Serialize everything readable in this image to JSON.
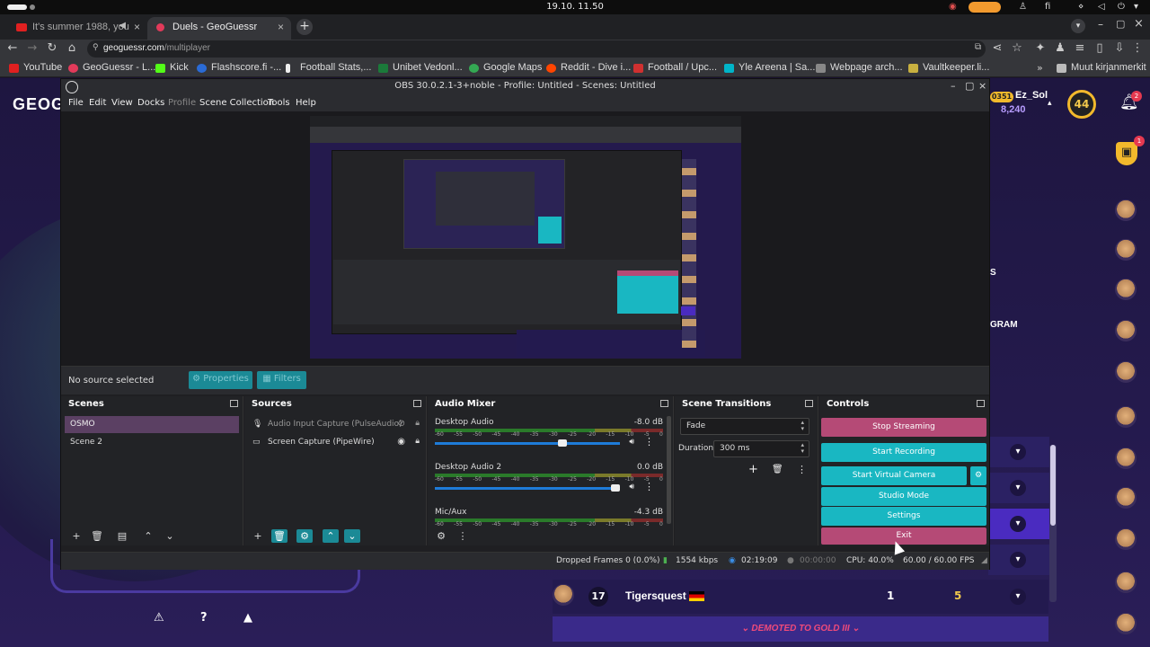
{
  "system": {
    "clock": "19.10.  11.50",
    "lang": "fi"
  },
  "browser": {
    "tabs": [
      {
        "title": "It's summer 1988, you",
        "favicon_color": "#e02020",
        "active": false
      },
      {
        "title": "Duels - GeoGuessr",
        "favicon_color": "#e23a5a",
        "active": true
      }
    ],
    "url_host": "geoguessr.com",
    "url_path": "/multiplayer",
    "bookmarks": [
      {
        "label": "YouTube",
        "color": "#e02020"
      },
      {
        "label": "GeoGuessr - L...",
        "color": "#e23a5a"
      },
      {
        "label": "Kick",
        "color": "#53fc18"
      },
      {
        "label": "Flashscore.fi -...",
        "color": "#2a6bd6"
      },
      {
        "label": "Football Stats,...",
        "color": "#eeeeee"
      },
      {
        "label": "Unibet Vedonl...",
        "color": "#1b7a3a"
      },
      {
        "label": "Google Maps",
        "color": "#34a853"
      },
      {
        "label": "Reddit - Dive i...",
        "color": "#ff4500"
      },
      {
        "label": "Football / Upc...",
        "color": "#d03030"
      },
      {
        "label": "Yle Areena | Sa...",
        "color": "#00b4c8"
      },
      {
        "label": "Webpage arch...",
        "color": "#888888"
      },
      {
        "label": "Vaultkeeper.li...",
        "color": "#c8b040"
      }
    ],
    "other_bookmarks": "Muut kirjanmerkit"
  },
  "geoguessr": {
    "logo": "GEOG",
    "username": "Ez_Sol",
    "points": "8,240",
    "rating_chip": "0351",
    "level": "44",
    "bell_badge": "2",
    "shield_badge": "1",
    "side_text_1": "S",
    "side_text_2": "GRAM",
    "player_rank": "17",
    "player_name": "Tigersquest",
    "player_val1": "1",
    "player_val2": "5",
    "demoted": "DEMOTED TO GOLD III"
  },
  "obs": {
    "title": "OBS 30.0.2.1-3+noble - Profile: Untitled - Scenes: Untitled",
    "menu": [
      "File",
      "Edit",
      "View",
      "Docks",
      "Profile",
      "Scene Collection",
      "Tools",
      "Help"
    ],
    "no_source": "No source selected",
    "properties_label": "Properties",
    "filters_label": "Filters",
    "docks": {
      "scenes": "Scenes",
      "sources": "Sources",
      "mixer": "Audio Mixer",
      "transitions": "Scene Transitions",
      "controls": "Controls"
    },
    "scenes": [
      {
        "name": "OSMO",
        "selected": true
      },
      {
        "name": "Scene 2",
        "selected": false
      }
    ],
    "sources": [
      {
        "name": "Audio Input Capture (PulseAudio)",
        "icon": "mic-icon",
        "visible": false
      },
      {
        "name": "Screen Capture (PipeWire)",
        "icon": "monitor-icon",
        "visible": true
      }
    ],
    "mixer": [
      {
        "name": "Desktop Audio",
        "db": "-8.0 dB",
        "level": 0.69
      },
      {
        "name": "Desktop Audio 2",
        "db": "0.0 dB",
        "level": 1.0
      },
      {
        "name": "Mic/Aux",
        "db": "-4.3 dB",
        "level": 0.8
      }
    ],
    "meter_scale": [
      "-60",
      "-55",
      "-50",
      "-45",
      "-40",
      "-35",
      "-30",
      "-25",
      "-20",
      "-15",
      "-10",
      "-5",
      "0"
    ],
    "transition": "Fade",
    "duration_label": "Duration",
    "duration": "300 ms",
    "controls": {
      "stop_streaming": "Stop Streaming",
      "start_recording": "Start Recording",
      "start_virtual_camera": "Start Virtual Camera",
      "studio_mode": "Studio Mode",
      "settings": "Settings",
      "exit": "Exit"
    },
    "status": {
      "dropped": "Dropped Frames 0 (0.0%)",
      "bitrate": "1554 kbps",
      "stream_time": "02:19:09",
      "rec_time": "00:00:00",
      "cpu": "CPU: 40.0%",
      "fps": "60.00 / 60.00 FPS"
    },
    "colors": {
      "teal": "#19b7c2",
      "rose": "#b54a76",
      "scene_selected": "#5b4063"
    }
  }
}
